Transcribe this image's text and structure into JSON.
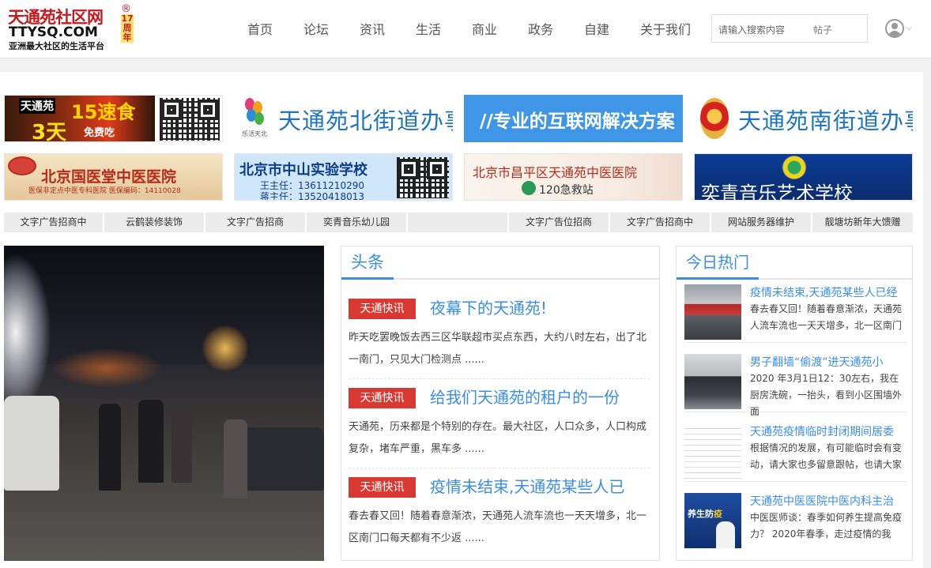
{
  "brand": {
    "name": "天通苑社区网",
    "domain": "TTYSQ.COM",
    "slogan": "亚洲最大社区的生活平台",
    "registered": "®",
    "anniversary_num": "17",
    "anniversary_zhou": "周",
    "anniversary_nian": "年",
    "brand_color": "#c6191d"
  },
  "nav": {
    "items": [
      "首页",
      "论坛",
      "资讯",
      "生活",
      "商业",
      "政务",
      "自建",
      "关于我们"
    ]
  },
  "search": {
    "placeholder": "请输入搜索内容",
    "type": "帖子"
  },
  "user": {
    "icon": "user-avatar-icon",
    "chevron": "⌵"
  },
  "ads": {
    "row1": {
      "food": {
        "brand": "天通苑",
        "days_num": "15",
        "offer": "速食",
        "trial": "3天",
        "free": "免费吃"
      },
      "north": {
        "caption": "乐活天北",
        "title": "天通苑北街道办事处"
      },
      "internet": {
        "title": "//专业的互联网解决方案"
      },
      "south": {
        "title": "天通苑南街道办事处"
      }
    },
    "row2": {
      "hospital": {
        "title": "北京国医堂中医医院",
        "note": "医保非定点中医专科医院  医保编码：14110028"
      },
      "school": {
        "title": "北京市中山实验学校",
        "principal": "王主任：13611210290",
        "principal2": "蒋主任：13520418013"
      },
      "tcm": {
        "title": "北京市昌平区天通苑中医医院",
        "emergency": "120急救站"
      },
      "music": {
        "title": "奕青音乐艺术学校"
      }
    }
  },
  "text_ads": [
    "文字广告招商中",
    "云鹤装修装饰",
    "文字广告招商",
    "奕青音乐幼儿园",
    "",
    "文字广告位招商",
    "文字广告招商中",
    "网站服务器维护",
    "靓塘坊新年大馈赠"
  ],
  "headlines": {
    "title": "头条",
    "articles": [
      {
        "tag": "天通快讯",
        "title": "夜幕下的天通苑!",
        "excerpt": "昨天吃罢晚饭去西三区华联超市买点东西，大约八时左右，出了北一南门，只见大门检测点 ......"
      },
      {
        "tag": "天通快讯",
        "title": "给我们天通苑的租户的一份",
        "excerpt": "天通苑，历来都是个特别的存在。最大社区，人口众多，人口构成复杂，堵车严重，黑车多 ......"
      },
      {
        "tag": "天通快讯",
        "title": "疫情未结束,天通苑某些人已",
        "excerpt": "春去春又回！随着春意渐浓，天通苑人流车流也一天天增多，北一区南门口每天都有不少返 ......"
      }
    ]
  },
  "hot": {
    "title": "今日热门",
    "items": [
      {
        "title": "疫情未结束,天通苑某些人已经",
        "excerpt": "春去春又回！随着春意渐浓，天通苑人流车流也一天天增多，北一区南门"
      },
      {
        "title": "男子翻墙“偷渡”进天通苑小",
        "excerpt": "2020 年3月1日12：30左右，我在厨房洗碗，一抬头，看到小区围墙外面"
      },
      {
        "title": "天通苑疫情临时封闭期间居委",
        "excerpt": "根据情况的发展，有可能临时会有变动，请大家也多留意跟帖，也请大家"
      },
      {
        "title": "天通苑中医医院中医内科主治",
        "excerpt": "中医医师谈：春季如何养生提高免疫力？ 2020年春季，走过疫情的我"
      }
    ],
    "thumb4_text": "养生防",
    "thumb4_highlight": "疫"
  },
  "colors": {
    "accent": "#3a8ee6",
    "tag_red": "#d83a33"
  }
}
